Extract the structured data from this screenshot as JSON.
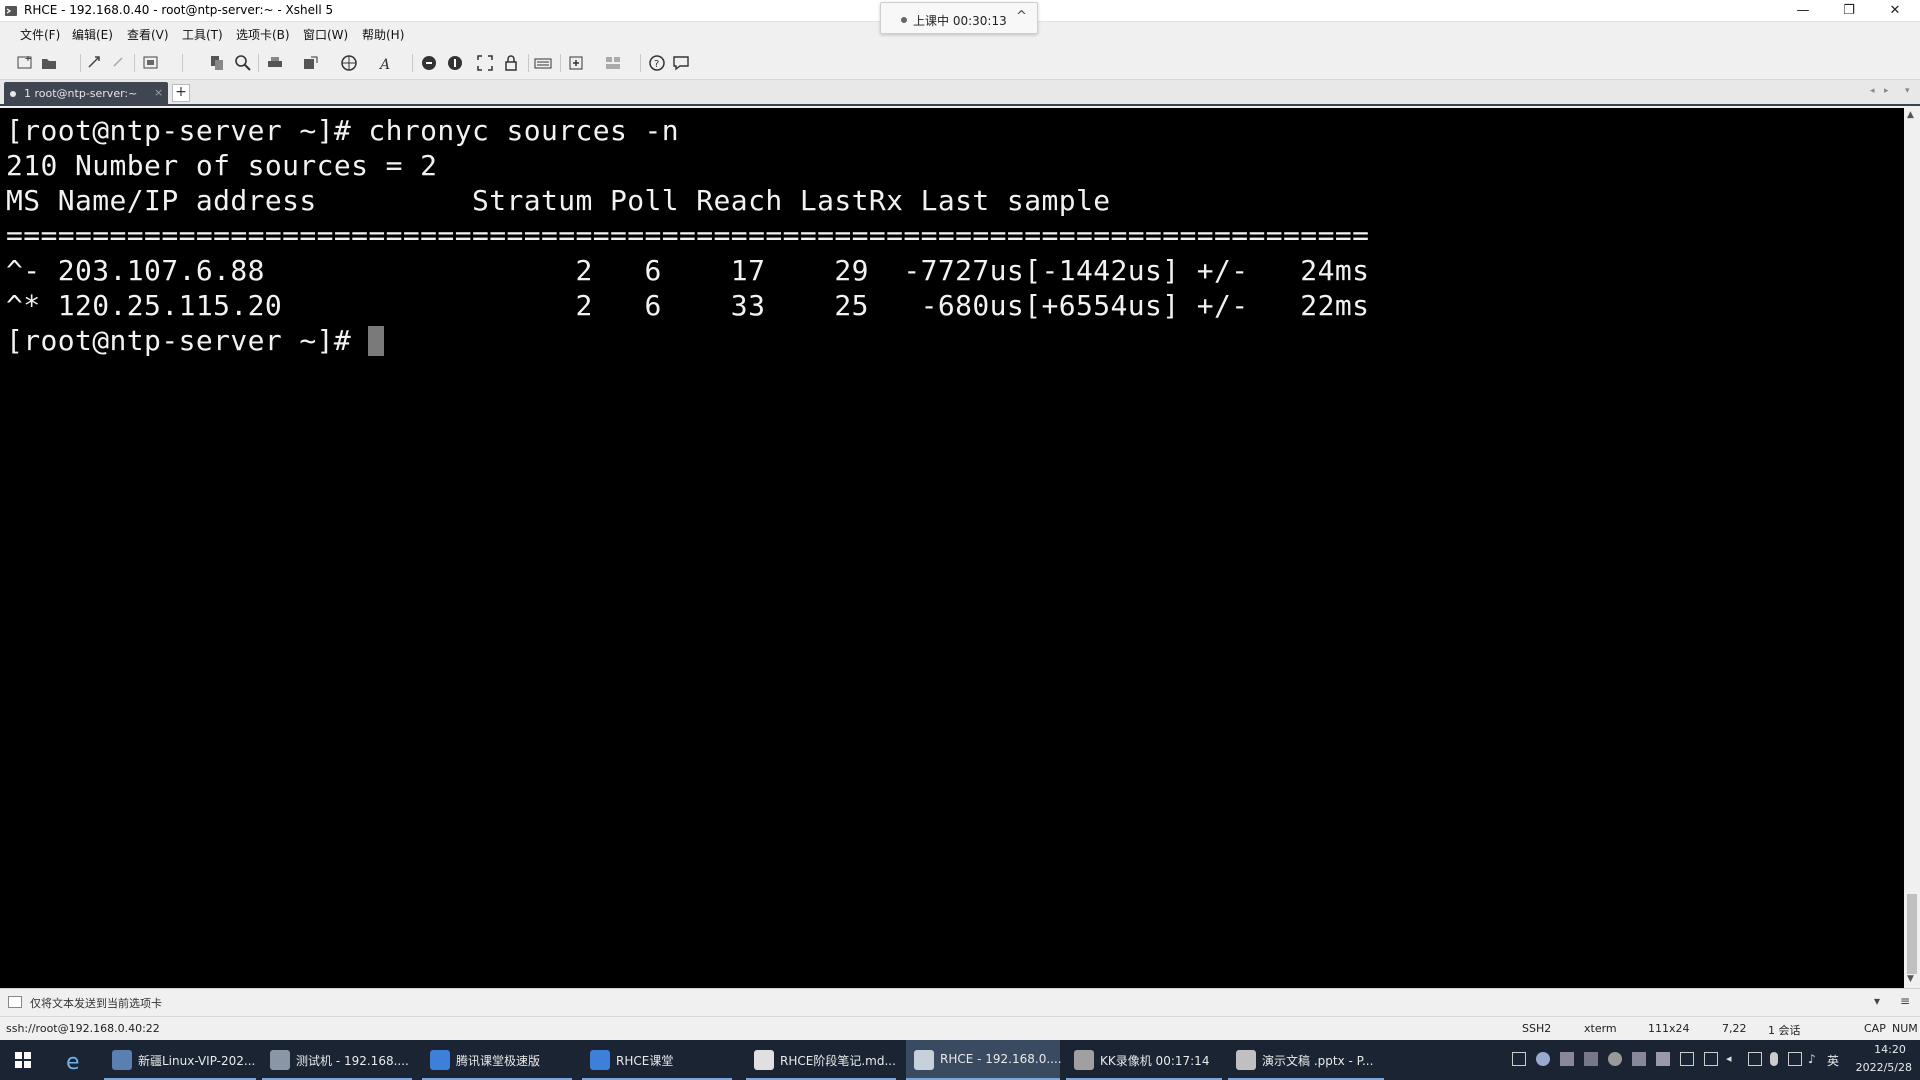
{
  "window": {
    "title": "RHCE - 192.168.0.40 - root@ntp-server:~ - Xshell 5",
    "minimize": "—",
    "maximize": "❐",
    "close": "✕"
  },
  "session_pill": {
    "label": "上课中 00:30:13",
    "chevron": "^"
  },
  "menu": [
    "文件(F)",
    "编辑(E)",
    "查看(V)",
    "工具(T)",
    "选项卡(B)",
    "窗口(W)",
    "帮助(H)"
  ],
  "toolbar_icons": [
    "new-session-icon",
    "open-folder-icon",
    "reconnect-icon",
    "disconnect-icon",
    "properties-icon",
    "copy-icon",
    "find-icon",
    "print-icon",
    "transfer-icon",
    "globe-icon",
    "font-icon",
    "xftp-icon",
    "xagent-icon",
    "fullscreen-icon",
    "lock-icon",
    "keyboard-icon",
    "new-tab-icon",
    "layout-icon",
    "help-icon",
    "chat-icon"
  ],
  "tab": {
    "label": "1 root@ntp-server:~",
    "close": "×",
    "new": "+"
  },
  "terminal": {
    "lines": [
      "[root@ntp-server ~]# chronyc sources -n",
      "210 Number of sources = 2",
      "MS Name/IP address         Stratum Poll Reach LastRx Last sample",
      "===============================================================================",
      "^- 203.107.6.88                  2   6    17    29  -7727us[-1442us] +/-   24ms",
      "^* 120.25.115.20                 2   6    33    25   -680us[+6554us] +/-   22ms"
    ],
    "prompt": "[root@ntp-server ~]# "
  },
  "compose": {
    "text": "仅将文本发送到当前选项卡",
    "menu_glyph": "≡",
    "dropdown_glyph": "▾"
  },
  "status": {
    "connection": "ssh://root@192.168.0.40:22",
    "protocol": "SSH2",
    "term": "xterm",
    "size": "111x24",
    "cursor_pos": "7,22",
    "sessions": "1 会话",
    "cap": "CAP",
    "num": "NUM"
  },
  "taskbar": {
    "items": [
      {
        "label": "新疆Linux-VIP-202...",
        "color": "#5a7fb0"
      },
      {
        "label": "测试机 - 192.168....",
        "color": "#8a95a5"
      },
      {
        "label": "腾讯课堂极速版",
        "color": "#3d7fd9"
      },
      {
        "label": "RHCE课堂",
        "color": "#3d7fd9"
      },
      {
        "label": "RHCE阶段笔记.md...",
        "color": "#e0e0e0"
      },
      {
        "label": "RHCE - 192.168.0....",
        "color": "#c8d0dc"
      },
      {
        "label": "KK录像机 00:17:14",
        "color": "#a0a0a0"
      },
      {
        "label": "演示文稿 .pptx - P...",
        "color": "#c0c0c0"
      }
    ],
    "ime": "英",
    "time": "14:20",
    "date": "2022/5/28"
  }
}
